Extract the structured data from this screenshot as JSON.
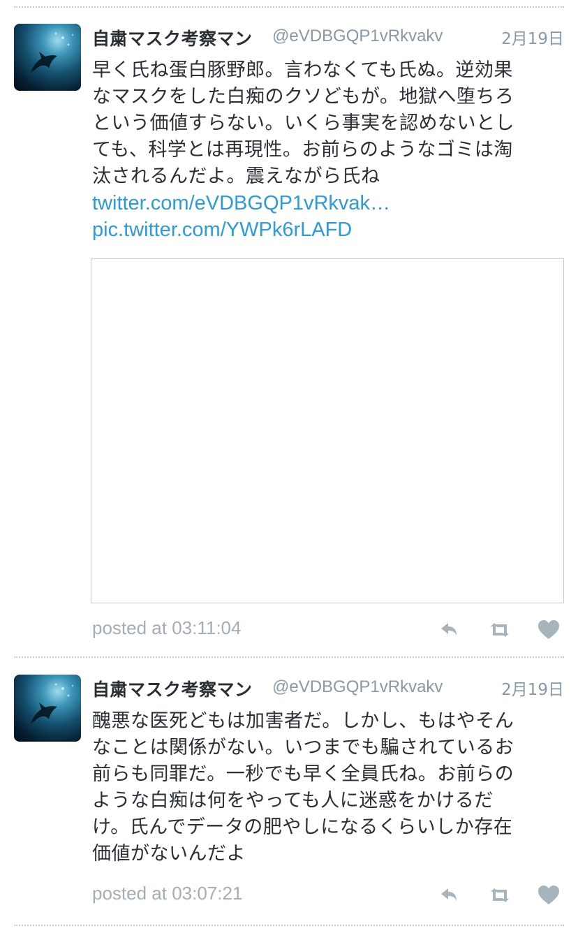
{
  "tweets": [
    {
      "display_name": "自粛マスク考察マン",
      "screen_name": "@eVDBGQP1vRkvakv",
      "date": "2月19日",
      "text_lines": [
        "早く氏ね蛋白豚野郎。言わなくても氏ぬ。逆効果",
        "なマスクをした白痴のクソどもが。地獄へ堕ちろ",
        "という価値すらない。いくら事実を認めないとし",
        "ても、科学とは再現性。お前らのようなゴミは淘",
        "汰されるんだよ。震えながら氏ね"
      ],
      "links": [
        "twitter.com/eVDBGQP1vRkvak…",
        "pic.twitter.com/YWPk6rLAFD"
      ],
      "posted": "posted at 03:11:04"
    },
    {
      "display_name": "自粛マスク考察マン",
      "screen_name": "@eVDBGQP1vRkvakv",
      "date": "2月19日",
      "text_lines": [
        "醜悪な医死どもは加害者だ。しかし、もはやそん",
        "なことは関係がない。いつまでも騙されているお",
        "前らも同罪だ。一秒でも早く全員氏ね。お前らの",
        "ような白痴は何をやっても人に迷惑をかけるだ",
        "け。氏んでデータの肥やしになるくらいしか存在",
        "価値がないんだよ"
      ],
      "links": [],
      "posted": "posted at 03:07:21"
    }
  ],
  "icons": {
    "reply": "reply-icon",
    "retweet": "retweet-icon",
    "like": "heart-icon"
  },
  "colors": {
    "link": "#2b9bd9",
    "muted": "#8899a6",
    "icon": "#a8b4bc",
    "divider": "#c9cdd1"
  }
}
